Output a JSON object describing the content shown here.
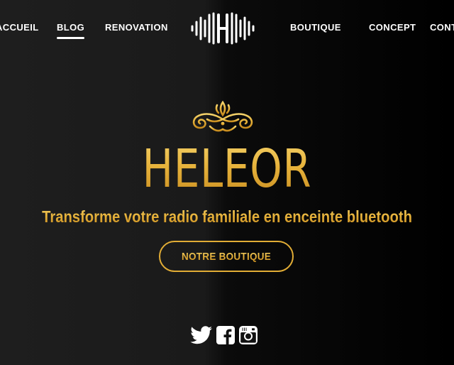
{
  "nav": {
    "items": [
      {
        "label": "ACCUEIL",
        "active": false
      },
      {
        "label": "BLOG",
        "active": true
      },
      {
        "label": "RENOVATION",
        "active": false
      },
      {
        "label": "BOUTIQUE",
        "active": false
      },
      {
        "label": "CONCEPT",
        "active": false
      },
      {
        "label": "CONTACT",
        "active": false
      }
    ],
    "logo_icon": "soundwave-h-logo"
  },
  "hero": {
    "ornament_icon": "gold-filigree-ornament",
    "title": "HELEOR",
    "tagline": "Transforme votre radio familiale en enceinte bluetooth",
    "cta_label": "NOTRE BOUTIQUE"
  },
  "social": {
    "icons": [
      "twitter-icon",
      "facebook-icon",
      "instagram-icon"
    ]
  },
  "colors": {
    "gold_light": "#f4d36c",
    "gold": "#e2ad35",
    "gold_dark": "#c68a1d",
    "background": "#1a1a1a",
    "text": "#ffffff"
  }
}
